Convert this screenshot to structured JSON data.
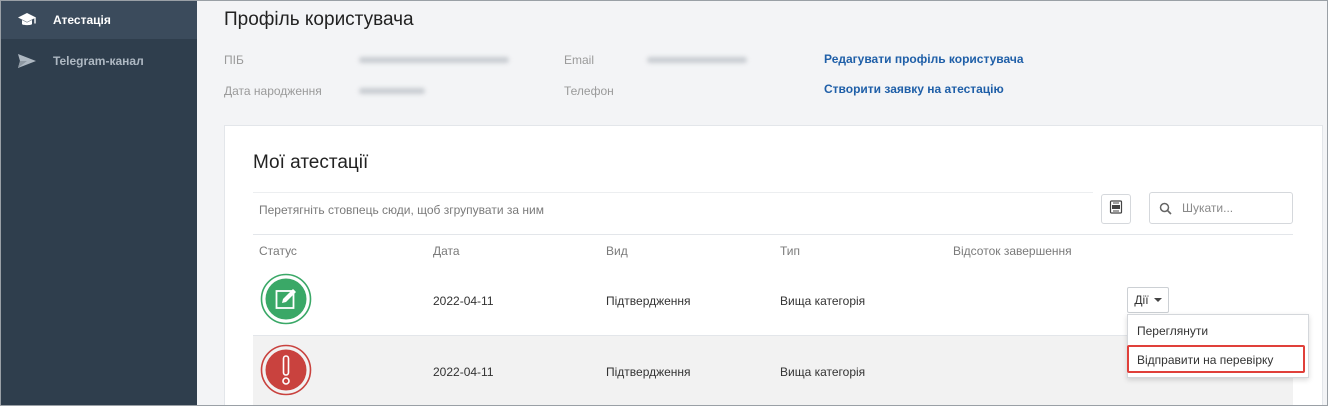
{
  "sidebar": {
    "items": [
      {
        "label": "Атестація",
        "icon": "graduation-cap-icon",
        "active": true
      },
      {
        "label": "Telegram-канал",
        "icon": "telegram-send-icon",
        "active": false
      }
    ]
  },
  "profile": {
    "title": "Профіль користувача",
    "fields": {
      "name_label": "ПІБ",
      "birth_label": "Дата народження",
      "email_label": "Email",
      "phone_label": "Телефон"
    },
    "links": {
      "edit_profile": "Редагувати профіль користувача",
      "create_request": "Створити заявку на атестацію"
    }
  },
  "attestations": {
    "title": "Мої атестації",
    "group_panel_text": "Перетягніть стовпець сюди, щоб згрупувати за ним",
    "search_placeholder": "Шукати...",
    "export_icon": "excel-export-icon",
    "columns": [
      "Статус",
      "Дата",
      "Вид",
      "Тип",
      "Відсоток завершення"
    ],
    "rows": [
      {
        "status": "edit-pending",
        "status_icon": "pencil-square-icon",
        "status_color": "#3aa867",
        "date": "2022-04-11",
        "kind": "Підтвердження",
        "type": "Вища категорія"
      },
      {
        "status": "warning",
        "status_icon": "exclamation-icon",
        "status_color": "#c9423e",
        "date": "2022-04-11",
        "kind": "Підтвердження",
        "type": "Вища категорія"
      }
    ],
    "actions_label": "Дії",
    "actions_menu": [
      {
        "label": "Переглянути"
      },
      {
        "label": "Відправити на перевірку",
        "highlighted": true
      }
    ]
  },
  "colors": {
    "sidebar_bg": "#2f3e4d",
    "link": "#1f5fa8",
    "highlight": "#e0403a"
  }
}
